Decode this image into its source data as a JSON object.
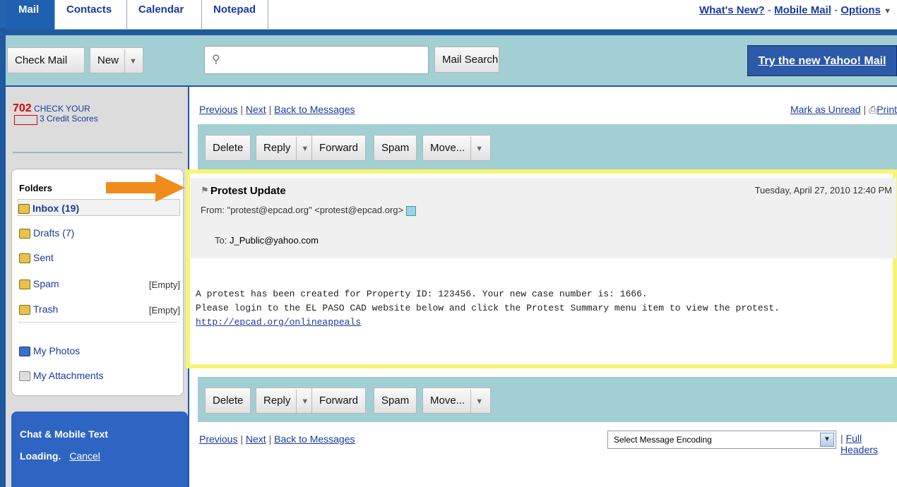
{
  "tabs": [
    "Mail",
    "Contacts",
    "Calendar",
    "Notepad"
  ],
  "top_links": {
    "whats_new": "What's New?",
    "mobile_mail": "Mobile Mail",
    "options": "Options"
  },
  "toolbar": {
    "check_mail": "Check Mail",
    "new": "New",
    "search_placeholder": "",
    "mail_search": "Mail Search",
    "try_new": "Try the new Yahoo! Mail"
  },
  "ad": {
    "number": "702",
    "line1": "CHECK YOUR",
    "line2": "3 Credit Scores"
  },
  "folders": {
    "title": "Folders",
    "items": [
      {
        "label": "Inbox (19)",
        "action": ""
      },
      {
        "label": "Drafts (7)",
        "action": ""
      },
      {
        "label": "Sent",
        "action": ""
      },
      {
        "label": "Spam",
        "action": "[Empty]"
      },
      {
        "label": "Trash",
        "action": "[Empty]"
      },
      {
        "label": "My Photos",
        "action": ""
      },
      {
        "label": "My Attachments",
        "action": ""
      }
    ]
  },
  "chat": {
    "title": "Chat & Mobile Text",
    "status": "Loading.",
    "cancel": "Cancel"
  },
  "nav": {
    "previous": "Previous",
    "next": "Next",
    "back": "Back to Messages",
    "mark_unread": "Mark as Unread",
    "print": "Print",
    "full_headers": "Full Headers"
  },
  "actions": {
    "delete": "Delete",
    "reply": "Reply",
    "forward": "Forward",
    "spam": "Spam",
    "move": "Move..."
  },
  "message": {
    "subject": "Protest Update",
    "date": "Tuesday, April 27, 2010 12:40 PM",
    "from_label": "From:",
    "from": "\"protest@epcad.org\" <protest@epcad.org>",
    "to_label": "To:",
    "to": "J_Public@yahoo.com",
    "body_line1": "A protest has been created for Property ID: 123456. Your new case number is: 1666.",
    "body_line2": "Please login to the EL PASO CAD website below and click the Protest Summary menu item to view the protest.",
    "link": "http://epcad.org/onlineappeals"
  },
  "encoding": {
    "selected": "Select Message Encoding"
  },
  "colors": {
    "highlight": "#f7f573",
    "arrow": "#f08c1c",
    "band": "#a2cfd3",
    "background": "#1f5aa0"
  }
}
